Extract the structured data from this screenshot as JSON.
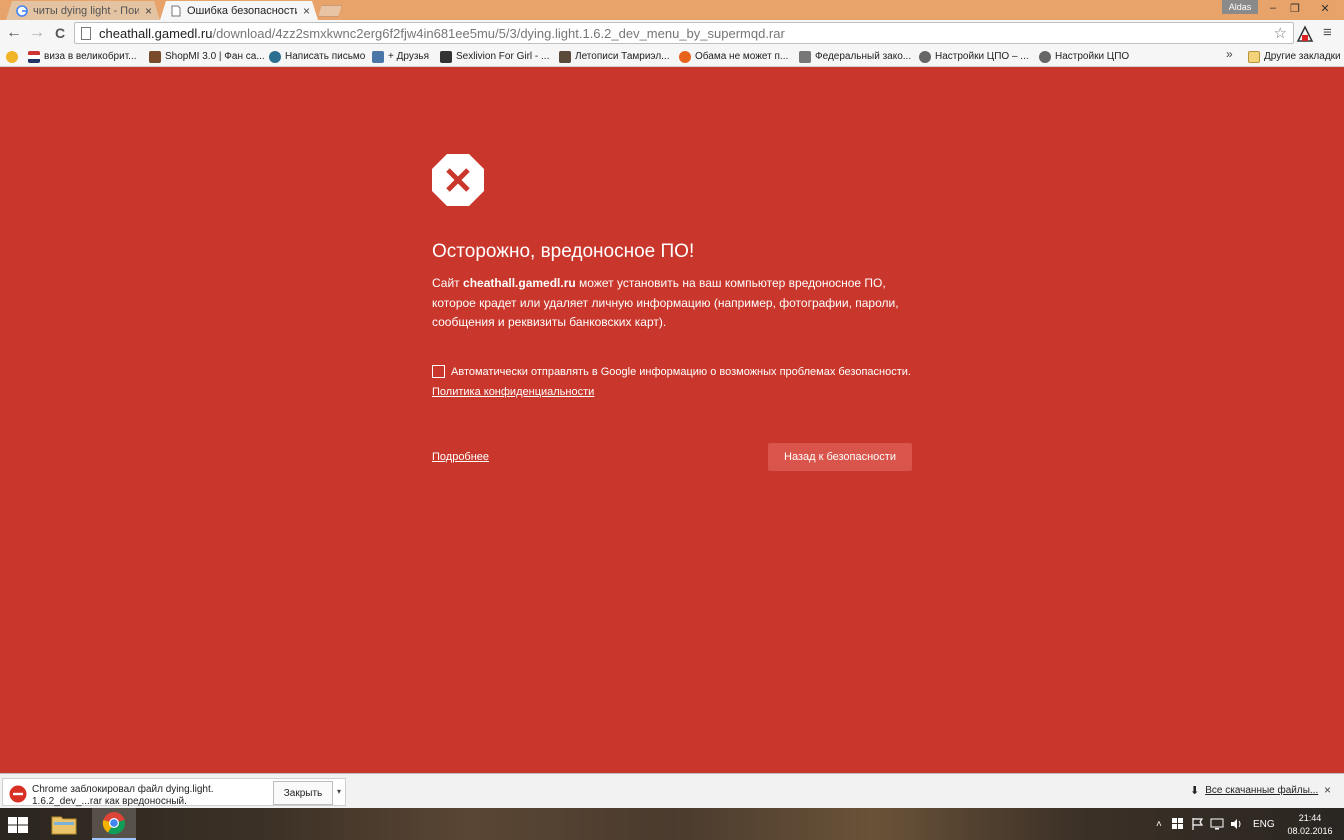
{
  "browser": {
    "tabs": [
      {
        "title": "читы dying light - Поиск",
        "active": false,
        "close": "×"
      },
      {
        "title": "Ошибка безопасности",
        "active": true,
        "close": "×"
      }
    ],
    "user": "Aldas",
    "window_controls": {
      "minimize": "‒",
      "restore": "❐",
      "close": "✕"
    }
  },
  "toolbar": {
    "back": "←",
    "forward": "→",
    "reload": "C",
    "url_host": "cheathall.gamedl.ru",
    "url_path": "/download/4zz2smxkwnc2erg6f2fjw4in681ee5mu/5/3/dying.light.1.6.2_dev_menu_by_supermqd.rar",
    "star": "☆",
    "menu": "≡"
  },
  "bookmarks": {
    "items": [
      {
        "label": "виза в великобрит...",
        "icon": "uk-flag-icon"
      },
      {
        "label": "ShopMI 3.0 | Фан са...",
        "icon": "game-icon"
      },
      {
        "label": "Написать письмо",
        "icon": "mail-icon"
      },
      {
        "label": "+ Друзья",
        "icon": "vk-icon"
      },
      {
        "label": "Sexlivion For Girl - ...",
        "icon": "skull-icon"
      },
      {
        "label": "Летописи Тамриэл...",
        "icon": "dragon-icon"
      },
      {
        "label": "Обама не может п...",
        "icon": "circle-icon"
      },
      {
        "label": "Федеральный зако...",
        "icon": "emblem-icon"
      },
      {
        "label": "Настройки ЦПО – ...",
        "icon": "gear-icon"
      },
      {
        "label": "Настройки ЦПО",
        "icon": "gear-icon"
      }
    ],
    "overflow": "»",
    "other": "Другие закладки"
  },
  "interstitial": {
    "heading": "Осторожно, вредоносное ПО!",
    "desc_prefix": "Сайт ",
    "desc_host": "cheathall.gamedl.ru",
    "desc_suffix": " может установить на ваш компьютер вредоносное ПО, которое крадет или удаляет личную информацию (например, фотографии, пароли, сообщения и реквизиты банковских карт).",
    "checkbox_label": "Автоматически отправлять в Google информацию о возможных проблемах безопасности.",
    "privacy_link": "Политика конфиденциальности",
    "details_link": "Подробнее",
    "back_button": "Назад к безопасности",
    "accent_color": "#c9372c"
  },
  "download_shelf": {
    "item_line1": "Chrome заблокировал файл dying.light.",
    "item_line2": "1.6.2_dev_...rar как вредоносный.",
    "close_button": "Закрыть",
    "show_all": "Все скачанные файлы...",
    "shelf_close": "×",
    "dropdown": "▾",
    "arrow": "⬇"
  },
  "taskbar": {
    "tray": {
      "up": "˄",
      "lang": "ENG"
    },
    "time": "21:44",
    "date": "08.02.2016"
  }
}
